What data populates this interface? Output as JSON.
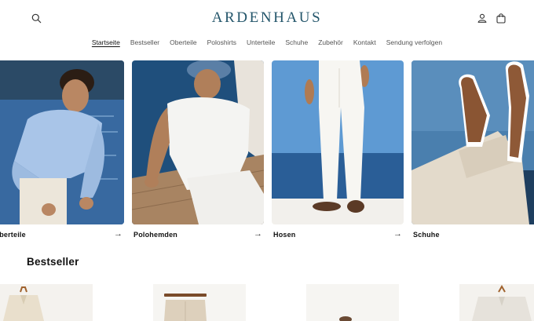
{
  "header": {
    "brand": "ARDENHAUS",
    "icons": {
      "search": "search-icon",
      "account": "account-icon",
      "cart": "cart-icon"
    },
    "brand_color": "#24566b"
  },
  "nav": {
    "items": [
      {
        "label": "Startseite",
        "active": true
      },
      {
        "label": "Bestseller"
      },
      {
        "label": "Oberteile"
      },
      {
        "label": "Poloshirts"
      },
      {
        "label": "Unterteile"
      },
      {
        "label": "Schuhe"
      },
      {
        "label": "Zubehör"
      },
      {
        "label": "Kontakt"
      },
      {
        "label": "Sendung verfolgen"
      }
    ]
  },
  "collections": [
    {
      "label": "Oberteile",
      "arrow": "→"
    },
    {
      "label": "Polohemden",
      "arrow": "→"
    },
    {
      "label": "Hosen",
      "arrow": "→"
    },
    {
      "label": "Schuhe",
      "arrow": "→"
    }
  ],
  "bestseller": {
    "title": "Bestseller"
  }
}
